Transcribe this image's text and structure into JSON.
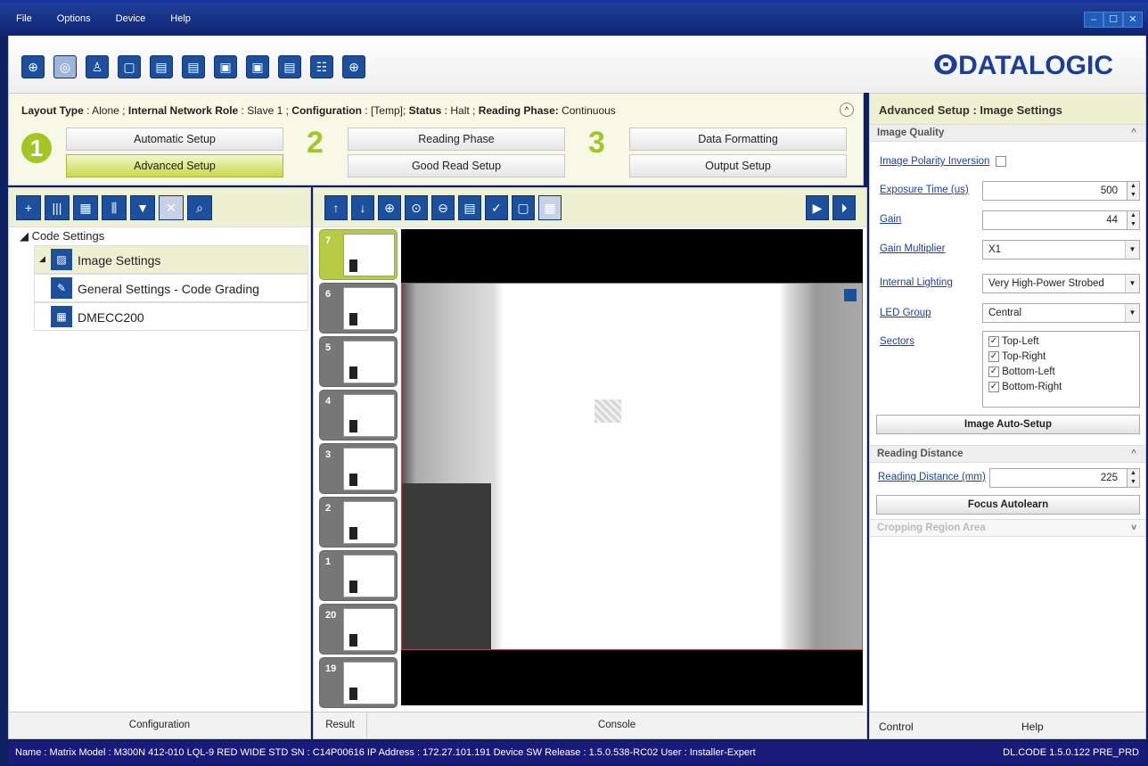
{
  "menu": [
    "File",
    "Options",
    "Device",
    "Help"
  ],
  "window_buttons": [
    "–",
    "☐",
    "✕"
  ],
  "toolbar_icons": [
    "crosshair-icon",
    "camera-icon",
    "user-icon",
    "layout-icon",
    "device-download-icon",
    "device-upload-icon",
    "save-icon",
    "export-icon",
    "monitor-icon",
    "settings-icon",
    "target-icon"
  ],
  "brand": "ⵙDATALOGIC",
  "setup": {
    "layout_type_label": "Layout Type",
    "layout_type_value": "Alone",
    "network_role_label": "Internal Network Role",
    "network_role_value": "Slave 1",
    "configuration_label": "Configuration",
    "configuration_value": "[Temp];",
    "status_label": "Status",
    "status_value": "Halt",
    "reading_phase_label": "Reading Phase:",
    "reading_phase_value": "Continuous",
    "steps": [
      "1",
      "2",
      "3"
    ],
    "buttons": {
      "automatic_setup": "Automatic Setup",
      "advanced_setup": "Advanced Setup",
      "reading_phase": "Reading Phase",
      "good_read_setup": "Good Read Setup",
      "data_formatting": "Data Formatting",
      "output_setup": "Output Setup"
    }
  },
  "right_panel": {
    "title": "Advanced Setup : Image Settings",
    "image_quality": "Image Quality",
    "polarity_inversion": "Image Polarity Inversion",
    "exposure_label": "Exposure Time (us)",
    "exposure_value": "500",
    "gain_label": "Gain",
    "gain_value": "44",
    "gain_multiplier_label": "Gain Multiplier",
    "gain_multiplier_value": "X1",
    "internal_lighting_label": "Internal Lighting",
    "internal_lighting_value": "Very High-Power Strobed",
    "led_group_label": "LED Group",
    "led_group_value": "Central",
    "sectors_label": "Sectors",
    "sectors": [
      "Top-Left",
      "Top-Right",
      "Bottom-Left",
      "Bottom-Right"
    ],
    "image_auto_setup": "Image Auto-Setup",
    "reading_distance_section": "Reading Distance",
    "reading_distance_label": "Reading Distance (mm)",
    "reading_distance_value": "225",
    "focus_autolearn": "Focus Autolearn",
    "cropping_region": "Cropping Region Area",
    "tabs": {
      "control": "Control",
      "help": "Help"
    }
  },
  "left_panel": {
    "tree_root": "Code Settings",
    "items": [
      "Image Settings",
      "General Settings - Code Grading",
      "DMECC200"
    ],
    "footer": "Configuration"
  },
  "center_panel": {
    "thumbnails": [
      "7",
      "6",
      "5",
      "4",
      "3",
      "2",
      "1",
      "20",
      "19"
    ],
    "tabs": {
      "result": "Result",
      "console": "Console"
    }
  },
  "statusbar": {
    "left": "Name : Matrix  Model : M300N 412-010 LQL-9 RED WIDE STD   SN : C14P00616   IP Address :  172.27.101.191   Device SW Release : 1.5.0.538-RC02   User : Installer-Expert",
    "right": "DL.CODE 1.5.0.122 PRE_PRD"
  }
}
